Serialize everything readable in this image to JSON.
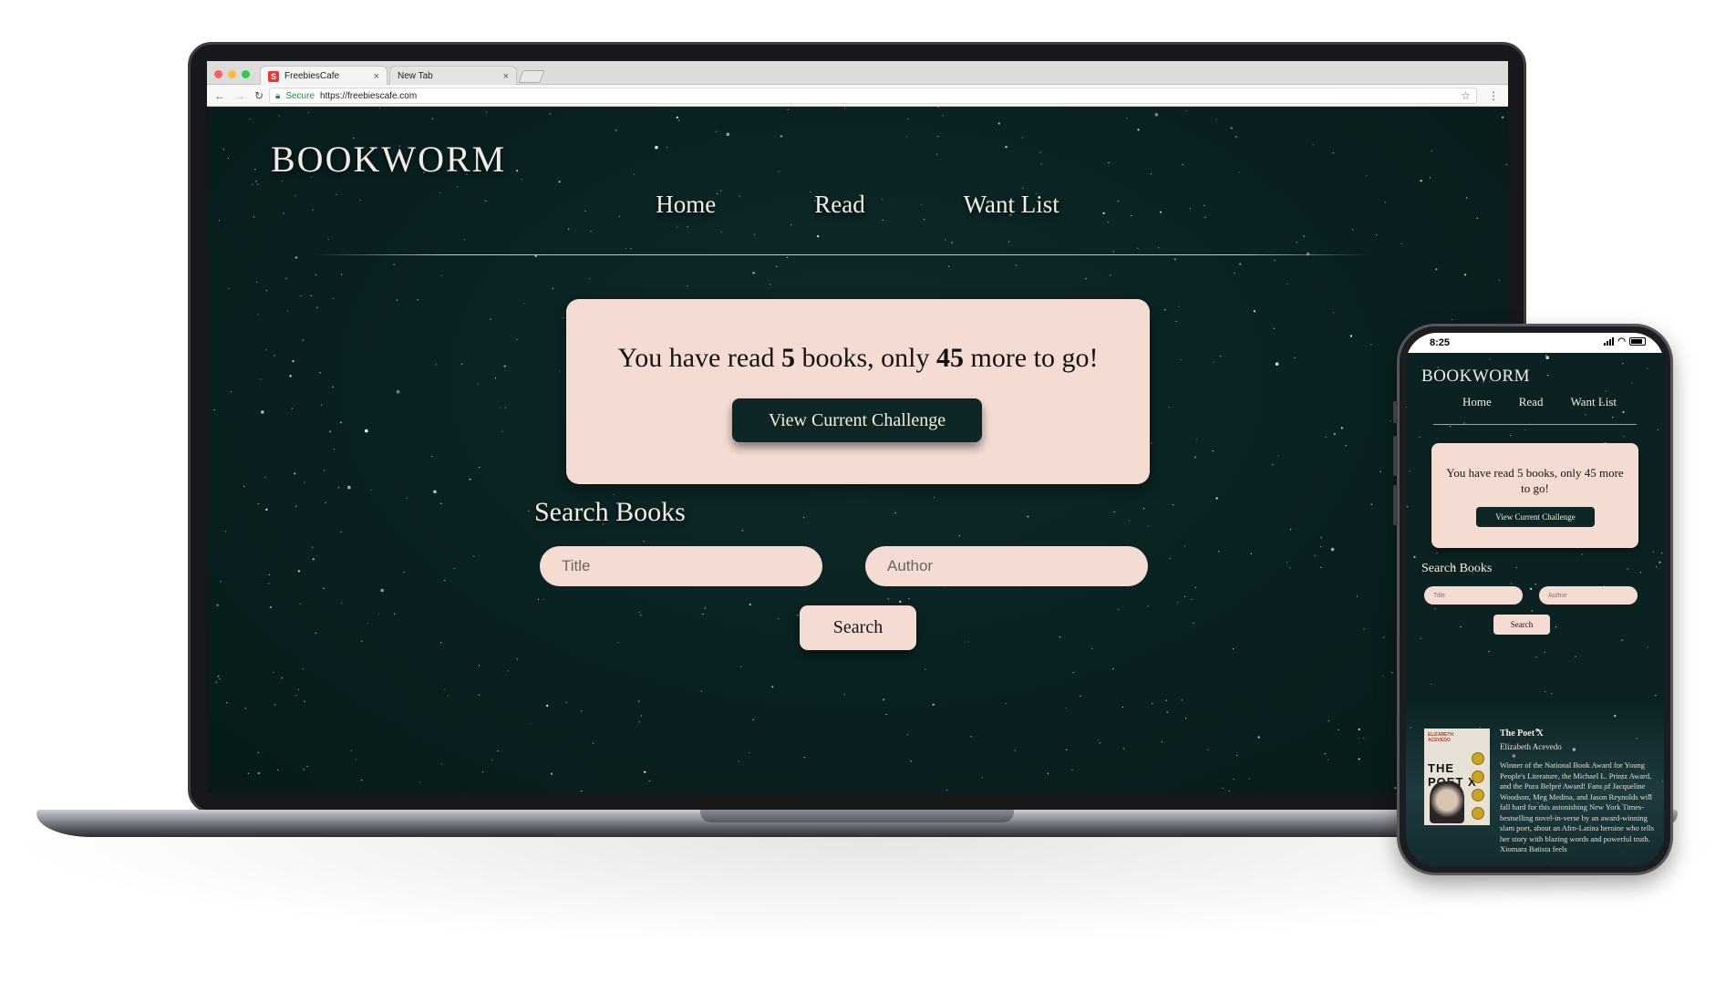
{
  "browser": {
    "tabs": [
      {
        "label": "FreebiesCafe",
        "favicon": "S"
      },
      {
        "label": "New Tab"
      }
    ],
    "secure_label": "Secure",
    "url": "https://freebiescafe.com"
  },
  "site": {
    "brand": "BOOKWORM",
    "nav": [
      "Home",
      "Read",
      "Want List"
    ],
    "challenge": {
      "prefix": "You have read ",
      "read_count": "5",
      "middle": " books, only ",
      "remaining": "45",
      "suffix": " more to go!",
      "button_label": "View Current Challenge"
    },
    "search": {
      "heading": "Search Books",
      "title_placeholder": "Title",
      "author_placeholder": "Author",
      "button_label": "Search"
    }
  },
  "mobile": {
    "status_time": "8:25",
    "challenge_text": "You have read 5 books, only 45 more to go!",
    "book": {
      "cover_author": "ELIZABETH ACEVEDO",
      "cover_title": "THE POET X",
      "title": "The Poet X",
      "author": "Elizabeth Acevedo",
      "description": "Winner of the National Book Award for Young People's Literature, the Michael L. Printz Award, and the Pura Belpré Award! Fans of Jacqueline Woodson, Meg Medina, and Jason Reynolds will fall hard for this astonishing New York Times-bestselling novel-in-verse by an award-winning slam poet, about an Afro-Latina heroine who tells her story with blazing words and powerful truth. Xiomara Batista feels"
    }
  },
  "colors": {
    "background_dark": "#0d2424",
    "card_pink": "#f5dcd3",
    "text_light": "#f3ece6",
    "button_dark": "#0e2626"
  }
}
